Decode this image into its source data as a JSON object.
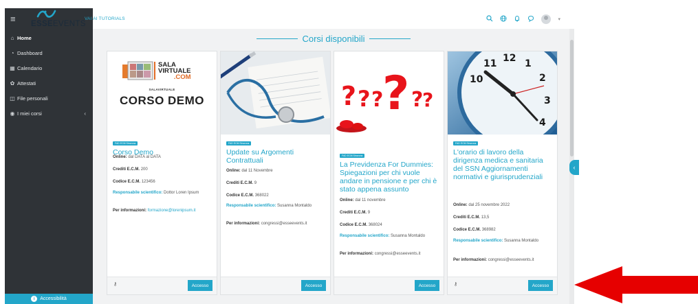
{
  "sidebar": {
    "items": [
      {
        "label": "Home",
        "icon": "home-icon"
      },
      {
        "label": "Dashboard",
        "icon": "dashboard-icon"
      },
      {
        "label": "Calendario",
        "icon": "calendar-icon"
      },
      {
        "label": "Attestati",
        "icon": "certificate-icon"
      },
      {
        "label": "File personali",
        "icon": "file-icon"
      },
      {
        "label": "I miei corsi",
        "icon": "courses-icon"
      }
    ],
    "accessibility": "Accessibilità"
  },
  "header": {
    "logo_bold": "ESSE",
    "logo_light": "EVENTS",
    "tutorials": "VAI AI TUTORIALS"
  },
  "section_title": "Corsi disponibili",
  "colors": {
    "accent": "#23a6c9",
    "sidebar": "#2f3337",
    "arrow": "#e60000"
  },
  "cards": [
    {
      "image_brand_line1": "SALA",
      "image_brand_line2": "VIRTUALE",
      "image_brand_line3": ".COM",
      "image_brand_small": "SALAVIRTUALE",
      "image_caption": "CORSO DEMO",
      "badge": "FAD ECM Sincrona",
      "title": "Corso Demo",
      "online_label": "Online:",
      "online_value": "dal DATA al DATA",
      "credits_label": "Crediti E.C.M.",
      "credits_value": "200",
      "code_label": "Codice E.C.M.",
      "code_value": "123456",
      "resp_label": "Responsabile scientifico:",
      "resp_value": "Dottor Loren Ipsum",
      "info_label": "Per informazioni:",
      "info_value": "formazione@lorenipsum.it",
      "button": "Accesso"
    },
    {
      "badge": "FAD ECM Sincrona",
      "title": "Update su Argomenti Contrattuali",
      "online_label": "Online:",
      "online_value": "dal 11 Novembre",
      "credits_label": "Crediti E.C.M.",
      "credits_value": "9",
      "code_label": "Codice E.C.M.",
      "code_value": "368022",
      "resp_label": "Responsabile scientifico:",
      "resp_value": "Susanna Montaldo",
      "info_label": "Per informazioni:",
      "info_value": "congressi@esseevents.it",
      "button": "Accesso"
    },
    {
      "badge": "FAD ECM Sincrona",
      "title": "La Previdenza For Dummies: Spiegazioni per chi vuole andare in pensione e per chi è stato appena assunto",
      "online_label": "Online:",
      "online_value": "dal 11 novembre",
      "credits_label": "Crediti E.C.M.",
      "credits_value": "9",
      "code_label": "Codice E.C.M.",
      "code_value": "368024",
      "resp_label": "Responsabile scientifico:",
      "resp_value": "Susanna Montaldo",
      "info_label": "Per informazioni:",
      "info_value": "congressi@esseevents.it",
      "button": "Accesso"
    },
    {
      "badge": "FAD ECM Sincrona",
      "title": "L'orario di lavoro della dirigenza medica e sanitaria del SSN Aggiornamenti normativi e giurisprudenziali",
      "online_label": "Online:",
      "online_value": "dal 25 novembre 2022",
      "credits_label": "Crediti E.C.M.",
      "credits_value": "13,5",
      "code_label": "Codice E.C.M.",
      "code_value": "368982",
      "resp_label": "Responsabile scientifico:",
      "resp_value": "Susanna Montaldo",
      "info_label": "Per informazioni:",
      "info_value": "congressi@esseevents.it",
      "button": "Accesso"
    }
  ]
}
